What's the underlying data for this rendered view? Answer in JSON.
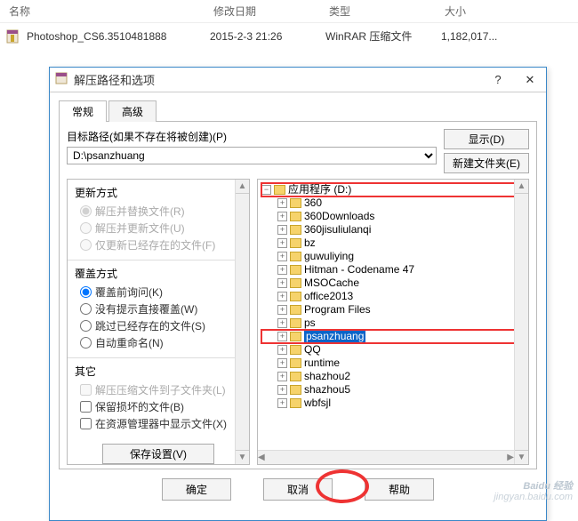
{
  "file_list": {
    "headers": {
      "name": "名称",
      "date": "修改日期",
      "type": "类型",
      "size": "大小"
    },
    "row": {
      "name": "Photoshop_CS6.3510481888",
      "date": "2015-2-3 21:26",
      "type": "WinRAR 压缩文件",
      "size": "1,182,017..."
    }
  },
  "dialog": {
    "title": "解压路径和选项",
    "help_icon": "?",
    "close_icon": "✕",
    "tabs": {
      "general": "常规",
      "advanced": "高级"
    },
    "path_label": "目标路径(如果不存在将被创建)(P)",
    "path_value": "D:\\psanzhuang",
    "show_btn": "显示(D)",
    "newfolder_btn": "新建文件夹(E)",
    "sections": {
      "update": {
        "title": "更新方式",
        "o1": "解压并替换文件(R)",
        "o2": "解压并更新文件(U)",
        "o3": "仅更新已经存在的文件(F)"
      },
      "overwrite": {
        "title": "覆盖方式",
        "o1": "覆盖前询问(K)",
        "o2": "没有提示直接覆盖(W)",
        "o3": "跳过已经存在的文件(S)",
        "o4": "自动重命名(N)"
      },
      "other": {
        "title": "其它",
        "o1": "解压压缩文件到子文件夹(L)",
        "o2": "保留损坏的文件(B)",
        "o3": "在资源管理器中显示文件(X)"
      }
    },
    "save_btn": "保存设置(V)",
    "tree": {
      "root": "应用程序 (D:)",
      "items": [
        "360",
        "360Downloads",
        "360jisuliulanqi",
        "bz",
        "guwuliying",
        "Hitman - Codename 47",
        "MSOCache",
        "office2013",
        "Program Files",
        "ps",
        "psanzhuang",
        "QQ",
        "runtime",
        "shazhou2",
        "shazhou5",
        "wbfsjl"
      ]
    },
    "footer": {
      "ok": "确定",
      "cancel": "取消",
      "help": "帮助"
    }
  },
  "watermark": {
    "brand": "Baidu 经验",
    "url": "jingyan.baidu.com"
  }
}
